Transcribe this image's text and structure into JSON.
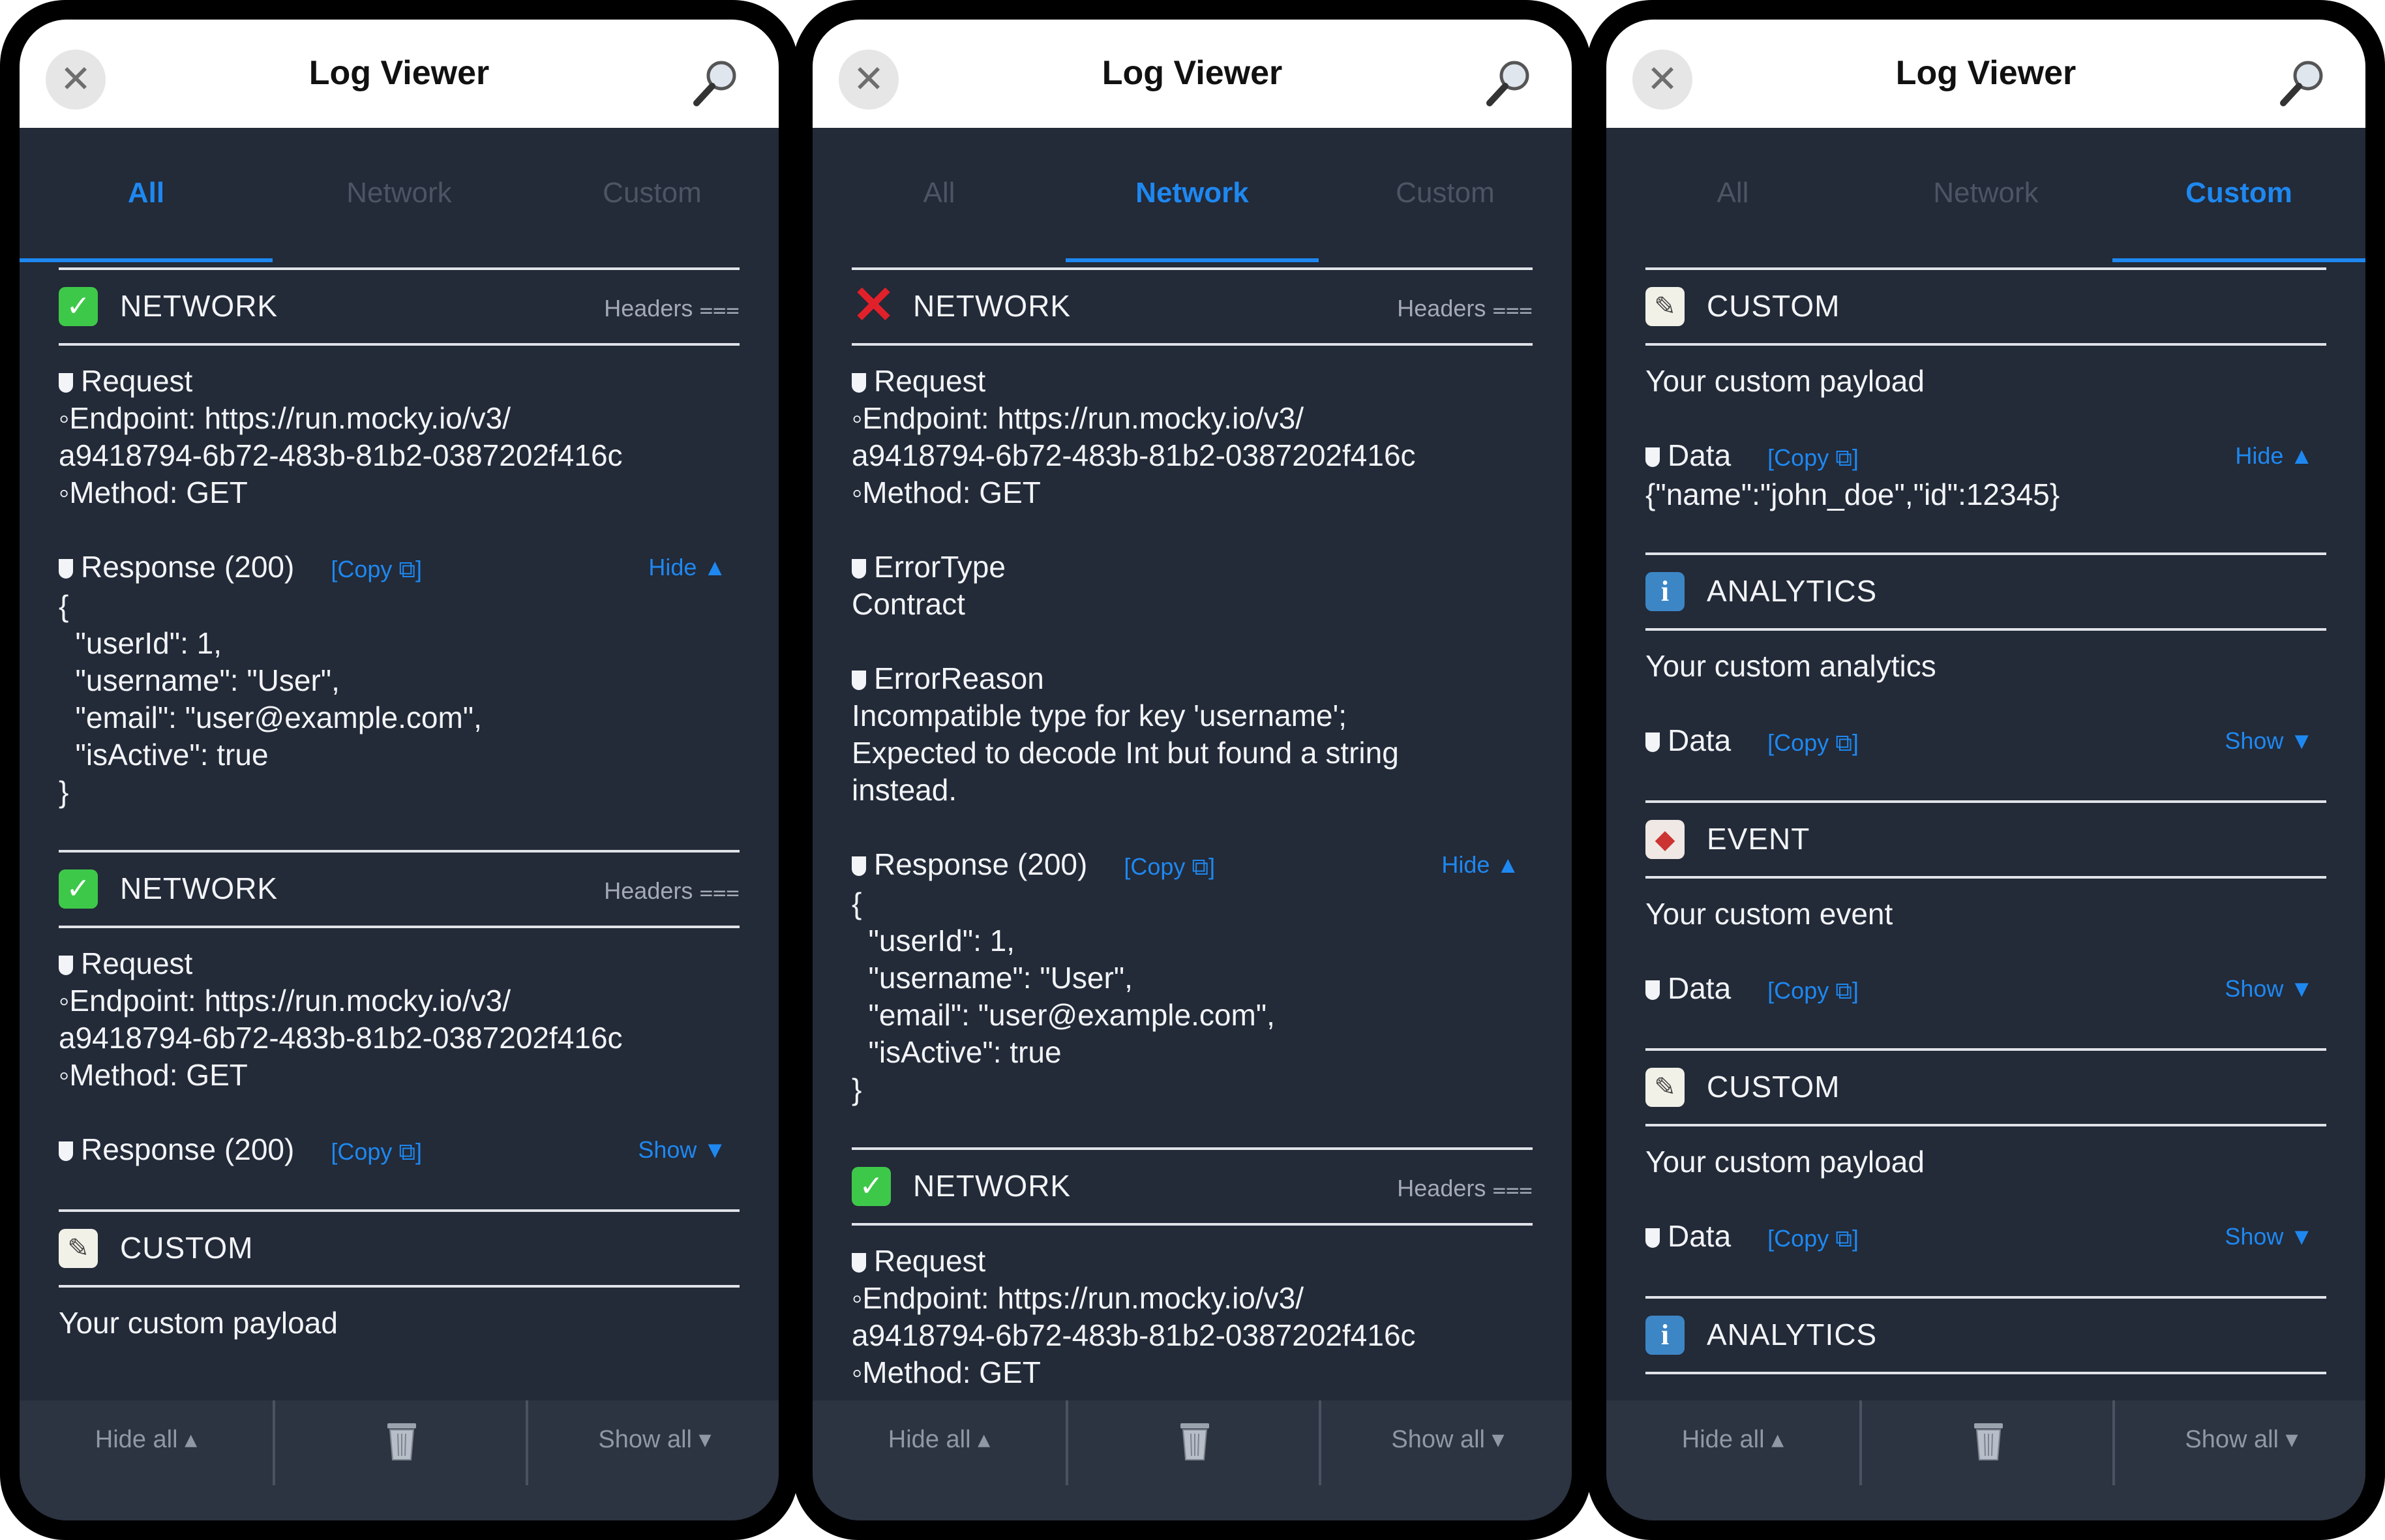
{
  "app": {
    "title": "Log Viewer",
    "tabs": [
      "All",
      "Network",
      "Custom"
    ]
  },
  "toolbar": {
    "hide_all": "Hide all ▴",
    "show_all": "Show all ▾"
  },
  "common": {
    "network": "NETWORK",
    "custom": "CUSTOM",
    "analytics": "ANALYTICS",
    "event": "EVENT",
    "headers": "Headers ⩶",
    "request": "Request",
    "endpoint1": "◦Endpoint: https://run.mocky.io/v3/",
    "endpoint2": "a9418794-6b72-483b-81b2-0387202f416c",
    "method": "◦Method: GET",
    "response": "Response (200)",
    "copy": "[Copy ⧉]",
    "hide": "Hide ▲",
    "show": "Show ▼",
    "json_open": "{",
    "json_userid": "  \"userId\": 1,",
    "json_username": "  \"username\": \"User\",",
    "json_email": "  \"email\": \"user@example.com\",",
    "json_active": "  \"isActive\": true",
    "json_close": "}",
    "payload": "Your custom payload",
    "analytics_text": "Your custom analytics",
    "event_text": "Your custom event",
    "data": "Data",
    "data_json": "{\"name\":\"john_doe\",\"id\":12345}"
  },
  "panel2": {
    "error_type": "ErrorType",
    "error_type_value": "Contract",
    "error_reason": "ErrorReason",
    "error_line1": "Incompatible type for key 'username';",
    "error_line2": "Expected to decode Int but found a string",
    "error_line3": "instead."
  },
  "icons": {
    "close": "close-icon",
    "search": "magnifier-icon",
    "success": "check-icon",
    "failure": "cross-icon",
    "custom": "memo-icon",
    "analytics": "info-icon",
    "event": "tag-icon",
    "trash": "trash-icon"
  },
  "colors": {
    "accent": "#1e88f0",
    "background": "#232a38",
    "success": "#3ec84a",
    "error": "#e2202a"
  }
}
